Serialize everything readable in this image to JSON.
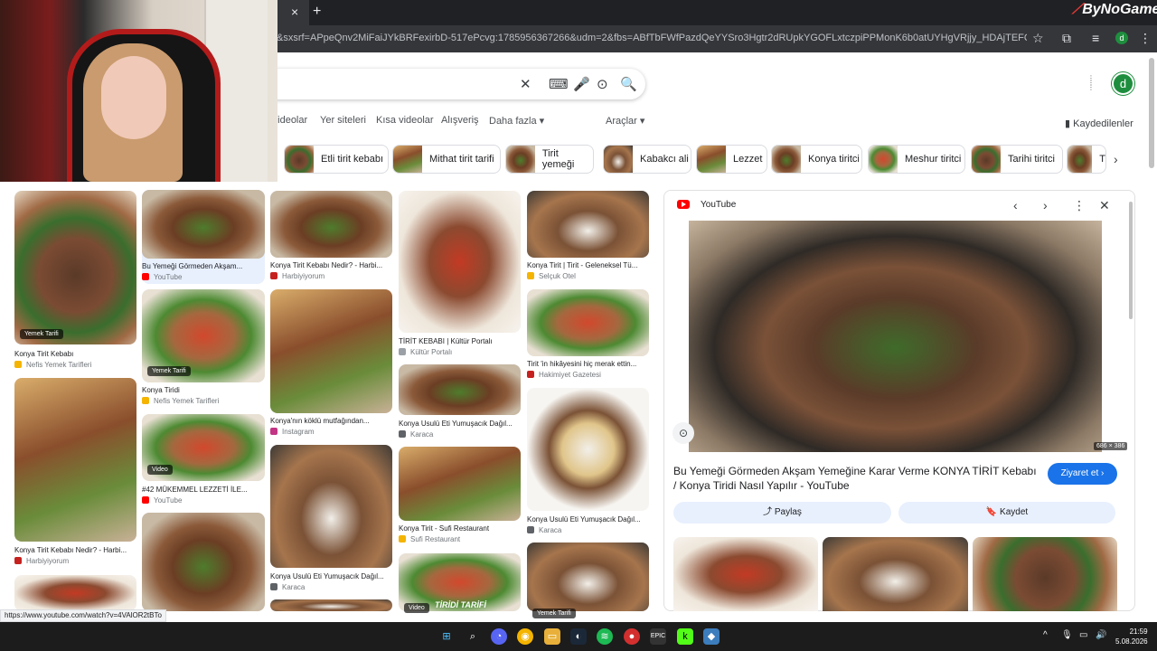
{
  "browser": {
    "tab_close": "×",
    "new_tab": "+",
    "url": "&sxsrf=APpeQnv2MiFaiJYkBRFexirbD-517ePcvg:1785956367266&udm=2&fbs=ABfTbFWfPazdQeYYSro3Hgtr2dRUpkYGOFLxtczpiPPMonK6b0atUYHgVRjjy_HDAjTEFQfjuG68nKYQULJEnKkNqMNI-04yZ...",
    "brand": "ByNoGame",
    "brand_flame": "⟋",
    "profile_initial": "d"
  },
  "search": {
    "clear_icon": "✕",
    "keyboard_icon": "⌨",
    "mic_icon": "🎤",
    "lens_icon": "⊙",
    "search_icon": "🔍"
  },
  "header": {
    "apps_icon": "⋮⋮⋮",
    "avatar_initial": "d",
    "tabs": [
      "Videolar",
      "Yer siteleri",
      "Kısa videolar",
      "Alışveriş",
      "Daha fazla ▾",
      "Araçlar ▾"
    ],
    "saved": "Kaydedilenler"
  },
  "chips": [
    "Etli tirit kebabı",
    "Mithat tirit tarifi",
    "Tirit yemeği",
    "Kabakcı ali",
    "Lezzet",
    "Konya tiritci",
    "Meshur tiritci",
    "Tarihi tiritci",
    "T"
  ],
  "chip_next": "›",
  "grid": {
    "col1": [
      {
        "badge": "Yemek Tarifi",
        "cap": "Konya Tirit Kebabı",
        "src": "Nefis Yemek Tarifleri"
      },
      {
        "badge": "",
        "cap": "Konya Tirit Kebabı Nedir? - Harbi...",
        "src": "Harbiyiyorum"
      }
    ],
    "col2": [
      {
        "badge": "",
        "cap": "Bu Yemeği Görmeden Akşam...",
        "src": "YouTube"
      },
      {
        "badge": "Yemek Tarifi",
        "cap": "Konya Tiridi",
        "src": "Nefis Yemek Tarifleri"
      },
      {
        "badge": "Video",
        "cap": "#42 MÜKEMMEL LEZZETİ İLE...",
        "src": "YouTube"
      }
    ],
    "col3": [
      {
        "badge": "",
        "cap": "Konya Tirit Kebabı Nedir? - Harbi...",
        "src": "Harbiyiyorum"
      },
      {
        "badge": "",
        "cap": "Konya'nın köklü mutfağından...",
        "src": "Instagram"
      },
      {
        "badge": "",
        "cap": "Konya Usulü Eti Yumuşacık Dağıl...",
        "src": "Karaca"
      }
    ],
    "col4": [
      {
        "badge": "",
        "cap": "TİRİT KEBABI | Kültür Portalı",
        "src": "Kültür Portalı"
      },
      {
        "badge": "",
        "cap": "Konya Usulü Eti Yumuşacık Dağıl...",
        "src": "Karaca"
      },
      {
        "badge": "",
        "cap": "Konya Tirit - Sufi Restaurant",
        "src": "Sufi Restaurant"
      },
      {
        "badge": "Video",
        "cap": "",
        "src": ""
      }
    ],
    "col5": [
      {
        "badge": "",
        "cap": "Konya Tirit | Tirit - Geleneksel Tü...",
        "src": "Selçuk Otel"
      },
      {
        "badge": "",
        "cap": "Tirit 'in hikâyesini hiç merak ettin...",
        "src": "Hakimiyet Gazetesi"
      },
      {
        "badge": "",
        "cap": "Konya Usulü Eti Yumuşacık Dağıl...",
        "src": "Karaca"
      },
      {
        "badge": "Yemek Tarifi",
        "cap": "",
        "src": ""
      }
    ],
    "overlay_text": "TİRİDİ TARİFİ"
  },
  "panel": {
    "source": "YouTube",
    "prev": "‹",
    "next": "›",
    "more": "⋮",
    "close": "✕",
    "image_size": "686 × 386",
    "title": "Bu Yemeği Görmeden Akşam Yemeğine Karar Verme KONYA TİRİT Kebabı / Konya Tiridi Nasıl Yapılır - YouTube",
    "visit": "Ziyaret et ›",
    "share": "⤴ Paylaş",
    "save": "🔖 Kaydet"
  },
  "status_url": "https://www.youtube.com/watch?v=4VAlOR2tBTo",
  "taskbar": {
    "time": "21:59",
    "date": "5.08.2026",
    "tray_expand": "^"
  }
}
